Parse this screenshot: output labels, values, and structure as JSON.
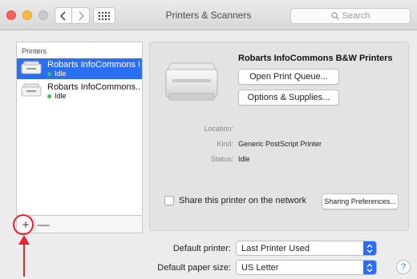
{
  "window": {
    "title": "Printers & Scanners"
  },
  "search": {
    "placeholder": "Search"
  },
  "sidebar": {
    "header": "Printers",
    "items": [
      {
        "name": "Robarts InfoCommons B...",
        "status": "Idle"
      },
      {
        "name": "Robarts InfoCommons...",
        "status": "Idle"
      }
    ],
    "add_symbol": "+",
    "remove_symbol": "—"
  },
  "detail": {
    "title": "Robarts InfoCommons B&W Printers",
    "open_queue_label": "Open Print Queue...",
    "options_label": "Options & Supplies...",
    "location_label": "Location:",
    "location_value": "",
    "kind_label": "Kind:",
    "kind_value": "Generic PostScript Printer",
    "status_label": "Status:",
    "status_value": "Idle",
    "share_label": "Share this printer on the network",
    "sharing_prefs_label": "Sharing Preferences..."
  },
  "defaults": {
    "printer_label": "Default printer:",
    "printer_value": "Last Printer Used",
    "paper_label": "Default paper size:",
    "paper_value": "US Letter"
  },
  "help_symbol": "?",
  "colors": {
    "accent": "#2a6ef1",
    "status_dot": "#3bc24a",
    "annotation": "#e8252f"
  }
}
